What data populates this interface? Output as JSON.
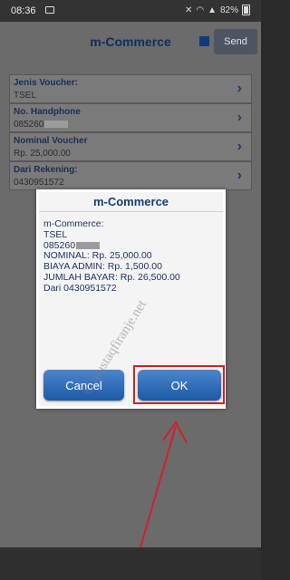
{
  "status_bar": {
    "time": "08:36",
    "battery": "82%"
  },
  "app_bar": {
    "title": "m-Commerce",
    "send_label": "Send"
  },
  "form": {
    "rows": [
      {
        "label": "Jenis Voucher:",
        "value": "TSEL"
      },
      {
        "label": "No. Handphone",
        "value": "085260"
      },
      {
        "label": "Nominal Voucher",
        "value": "Rp. 25,000.00"
      },
      {
        "label": "Dari Rekening:",
        "value": "0430951572"
      }
    ]
  },
  "dialog": {
    "title": "m-Commerce",
    "lines": [
      "m-Commerce:",
      "TSEL",
      "085260",
      "NOMINAL: Rp. 25,000.00",
      "BIAYA ADMIN: Rp. 1,500.00",
      "JUMLAH BAYAR: Rp. 26,500.00",
      "Dari 0430951572"
    ],
    "cancel_label": "Cancel",
    "ok_label": "OK"
  },
  "watermark": "© mustaqfiranje.net",
  "colors": {
    "accent": "#1d5aa6",
    "highlight": "#d32026",
    "title": "#163e7a"
  }
}
